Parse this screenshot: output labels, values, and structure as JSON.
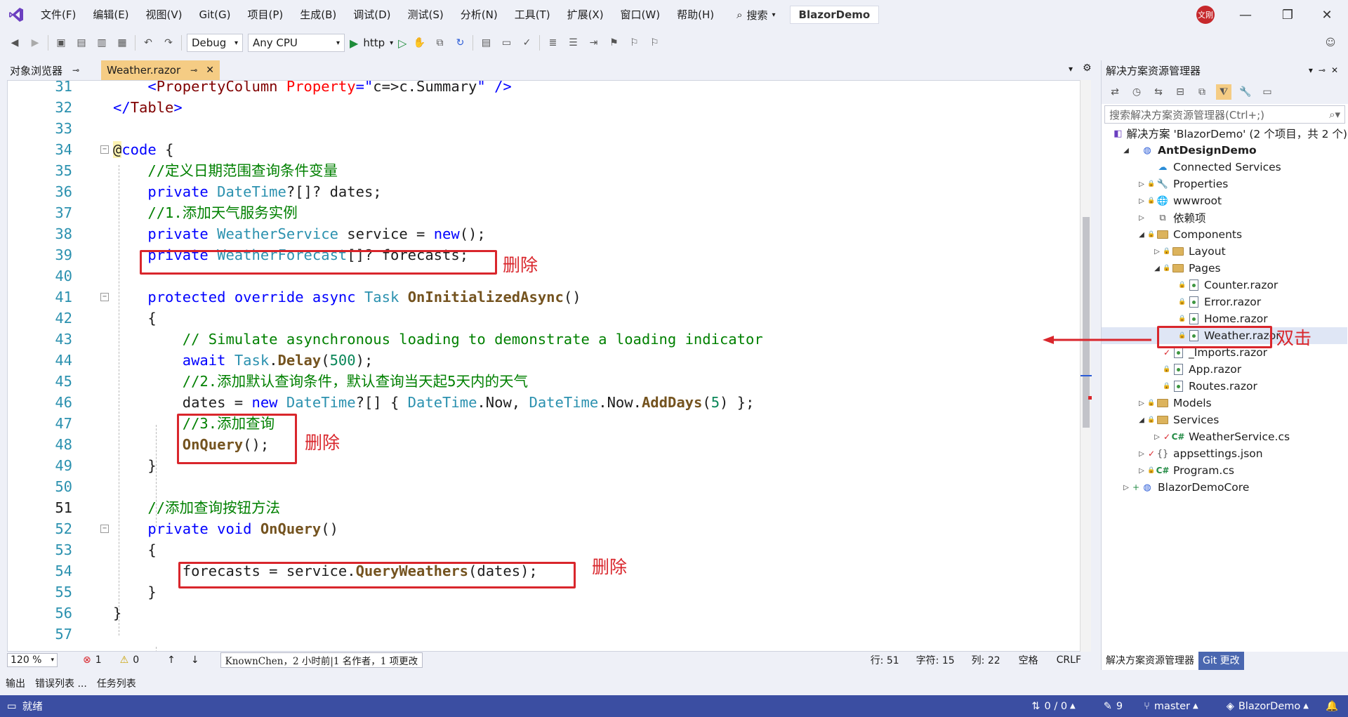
{
  "menu": [
    "文件(F)",
    "编辑(E)",
    "视图(V)",
    "Git(G)",
    "项目(P)",
    "生成(B)",
    "调试(D)",
    "测试(S)",
    "分析(N)",
    "工具(T)",
    "扩展(X)",
    "窗口(W)",
    "帮助(H)"
  ],
  "search_label": "搜索",
  "solution_name": "BlazorDemo",
  "avatar_text": "文刚",
  "toolbar": {
    "config": "Debug",
    "platform": "Any CPU",
    "run_target": "http"
  },
  "tabs": {
    "object_browser": "对象浏览器",
    "active_file": "Weather.razor"
  },
  "code_lines": [
    {
      "n": "31",
      "code": "    <PropertyColumn Property=\"c=>c.Summary\" />"
    },
    {
      "n": "32",
      "code": "</Table>"
    },
    {
      "n": "33",
      "code": ""
    },
    {
      "n": "34",
      "code": "@code {"
    },
    {
      "n": "35",
      "code": "    //定义日期范围查询条件变量"
    },
    {
      "n": "36",
      "code": "    private DateTime?[]? dates;"
    },
    {
      "n": "37",
      "code": "    //1.添加天气服务实例"
    },
    {
      "n": "38",
      "code": "    private WeatherService service = new();"
    },
    {
      "n": "39",
      "code": "    private WeatherForecast[]? forecasts;"
    },
    {
      "n": "40",
      "code": ""
    },
    {
      "n": "41",
      "code": "    protected override async Task OnInitializedAsync()"
    },
    {
      "n": "42",
      "code": "    {"
    },
    {
      "n": "43",
      "code": "        // Simulate asynchronous loading to demonstrate a loading indicator"
    },
    {
      "n": "44",
      "code": "        await Task.Delay(500);"
    },
    {
      "n": "45",
      "code": "        //2.添加默认查询条件，默认查询当天起5天内的天气"
    },
    {
      "n": "46",
      "code": "        dates = new DateTime?[] { DateTime.Now, DateTime.Now.AddDays(5) };"
    },
    {
      "n": "47",
      "code": "        //3.添加查询"
    },
    {
      "n": "48",
      "code": "        OnQuery();"
    },
    {
      "n": "49",
      "code": "    }"
    },
    {
      "n": "50",
      "code": ""
    },
    {
      "n": "51",
      "code": "    //添加查询按钮方法"
    },
    {
      "n": "52",
      "code": "    private void OnQuery()"
    },
    {
      "n": "53",
      "code": "    {"
    },
    {
      "n": "54",
      "code": "        forecasts = service.QueryWeathers(dates);"
    },
    {
      "n": "55",
      "code": "    }"
    },
    {
      "n": "56",
      "code": "}"
    },
    {
      "n": "57",
      "code": ""
    }
  ],
  "annotations": {
    "delete": "删除",
    "double_click": "双击"
  },
  "editor_status": {
    "zoom": "120 %",
    "errors": "1",
    "warnings": "0",
    "blame": "KnownChen，2 小时前|1 名作者，1 项更改",
    "line": "行: 51",
    "char": "字符: 15",
    "col": "列: 22",
    "whitespace": "空格",
    "eol": "CRLF"
  },
  "solution_explorer": {
    "title": "解决方案资源管理器",
    "search_placeholder": "搜索解决方案资源管理器(Ctrl+;)",
    "items": [
      {
        "label": "解决方案 'BlazorDemo' (2 个项目，共 2 个)",
        "indent": 0,
        "arrow": "",
        "icon": "solution"
      },
      {
        "label": "AntDesignDemo",
        "indent": 1,
        "arrow": "◢",
        "icon": "project",
        "bold": true
      },
      {
        "label": "Connected Services",
        "indent": 2,
        "arrow": "",
        "icon": "connected"
      },
      {
        "label": "Properties",
        "indent": 2,
        "arrow": "▷",
        "icon": "props",
        "lock": true
      },
      {
        "label": "wwwroot",
        "indent": 2,
        "arrow": "▷",
        "icon": "globe",
        "lock": true
      },
      {
        "label": "依赖项",
        "indent": 2,
        "arrow": "▷",
        "icon": "deps"
      },
      {
        "label": "Components",
        "indent": 2,
        "arrow": "◢",
        "icon": "folder",
        "lock": true
      },
      {
        "label": "Layout",
        "indent": 3,
        "arrow": "▷",
        "icon": "folder",
        "lock": true
      },
      {
        "label": "Pages",
        "indent": 3,
        "arrow": "◢",
        "icon": "folder",
        "lock": true
      },
      {
        "label": "Counter.razor",
        "indent": 4,
        "arrow": "",
        "icon": "razor",
        "lock": true
      },
      {
        "label": "Error.razor",
        "indent": 4,
        "arrow": "",
        "icon": "razor",
        "lock": true
      },
      {
        "label": "Home.razor",
        "indent": 4,
        "arrow": "",
        "icon": "razor",
        "lock": true
      },
      {
        "label": "Weather.razor",
        "indent": 4,
        "arrow": "",
        "icon": "razor",
        "lock": true,
        "sel": true
      },
      {
        "label": "_Imports.razor",
        "indent": 3,
        "arrow": "",
        "icon": "razor",
        "check": true
      },
      {
        "label": "App.razor",
        "indent": 3,
        "arrow": "",
        "icon": "razor",
        "lock": true
      },
      {
        "label": "Routes.razor",
        "indent": 3,
        "arrow": "",
        "icon": "razor",
        "lock": true
      },
      {
        "label": "Models",
        "indent": 2,
        "arrow": "▷",
        "icon": "folder",
        "lock": true
      },
      {
        "label": "Services",
        "indent": 2,
        "arrow": "◢",
        "icon": "folder",
        "lock": true
      },
      {
        "label": "WeatherService.cs",
        "indent": 3,
        "arrow": "▷",
        "icon": "cs",
        "check": true
      },
      {
        "label": "appsettings.json",
        "indent": 2,
        "arrow": "▷",
        "icon": "json",
        "check": true
      },
      {
        "label": "Program.cs",
        "indent": 2,
        "arrow": "▷",
        "icon": "cs",
        "lock": true
      },
      {
        "label": "BlazorDemoCore",
        "indent": 1,
        "arrow": "▷",
        "icon": "project",
        "plus": true
      }
    ],
    "bottom_tabs": [
      "解决方案资源管理器",
      "Git 更改"
    ]
  },
  "bottom_panels": [
    "输出",
    "错误列表 ...",
    "任务列表"
  ],
  "status": {
    "ready": "就绪",
    "sync": "0 / 0",
    "edits": "9",
    "branch": "master",
    "repo": "BlazorDemo"
  }
}
